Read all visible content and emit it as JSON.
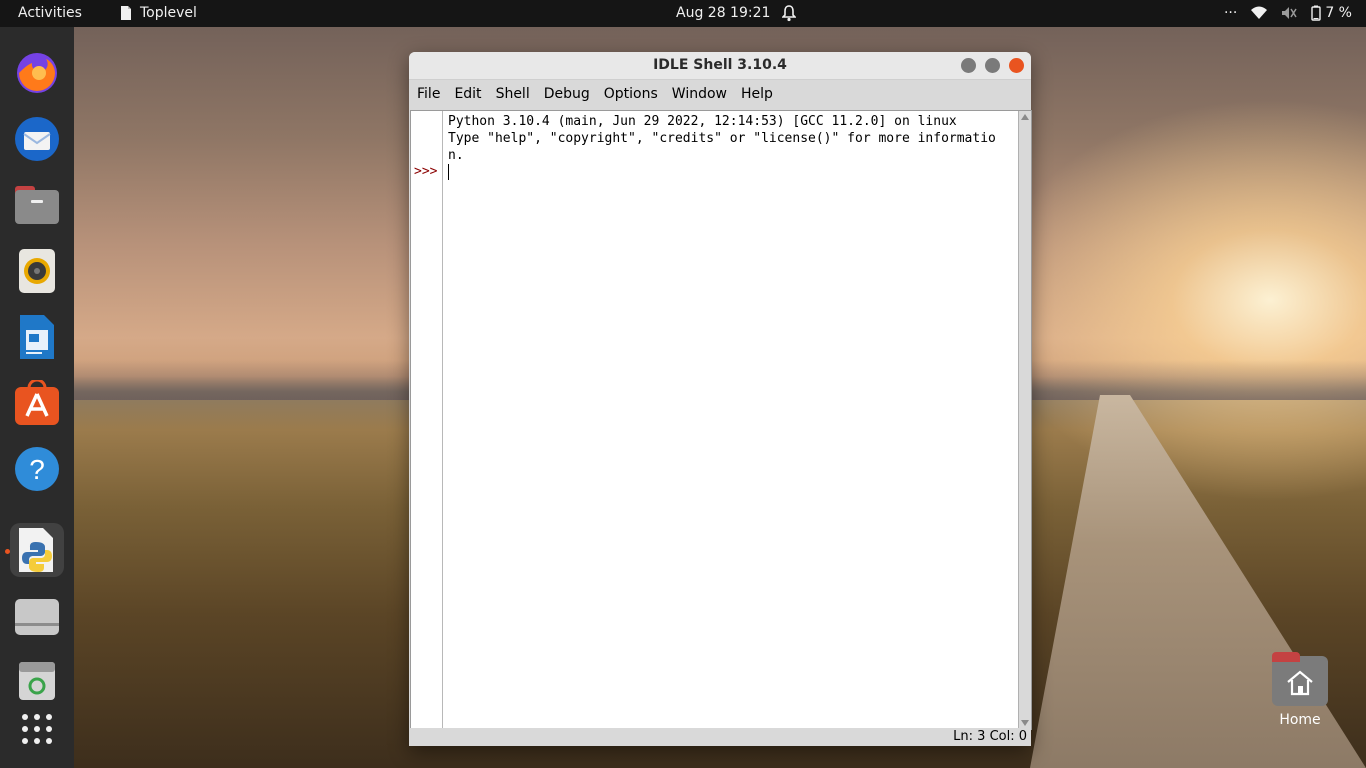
{
  "topbar": {
    "activities": "Activities",
    "app_name": "Toplevel",
    "clock": "Aug 28  19:21",
    "overflow": "···",
    "battery": "7 %"
  },
  "dock": {
    "items": [
      {
        "name": "firefox",
        "icon": "firefox-icon"
      },
      {
        "name": "thunderbird",
        "icon": "mail-icon"
      },
      {
        "name": "files",
        "icon": "folder-icon"
      },
      {
        "name": "rhythmbox",
        "icon": "speaker-icon"
      },
      {
        "name": "writer",
        "icon": "document-icon"
      },
      {
        "name": "app-center",
        "icon": "store-icon"
      },
      {
        "name": "help",
        "icon": "help-icon"
      },
      {
        "name": "idle",
        "icon": "python-icon"
      },
      {
        "name": "disk",
        "icon": "drive-icon"
      },
      {
        "name": "trash",
        "icon": "trash-icon"
      },
      {
        "name": "show-apps",
        "icon": "grid-icon"
      }
    ]
  },
  "window": {
    "title": "IDLE Shell 3.10.4",
    "menu": [
      "File",
      "Edit",
      "Shell",
      "Debug",
      "Options",
      "Window",
      "Help"
    ],
    "shell": {
      "prompt": ">>>",
      "lines": [
        "Python 3.10.4 (main, Jun 29 2022, 12:14:53) [GCC 11.2.0] on linux",
        "Type \"help\", \"copyright\", \"credits\" or \"license()\" for more informatio",
        "n."
      ]
    },
    "status": "Ln: 3   Col: 0"
  },
  "desktop": {
    "home_label": "Home"
  },
  "colors": {
    "accent": "#e95420",
    "prompt": "#8b0000",
    "topbar": "#151515",
    "dock": "#2b2b2b"
  }
}
